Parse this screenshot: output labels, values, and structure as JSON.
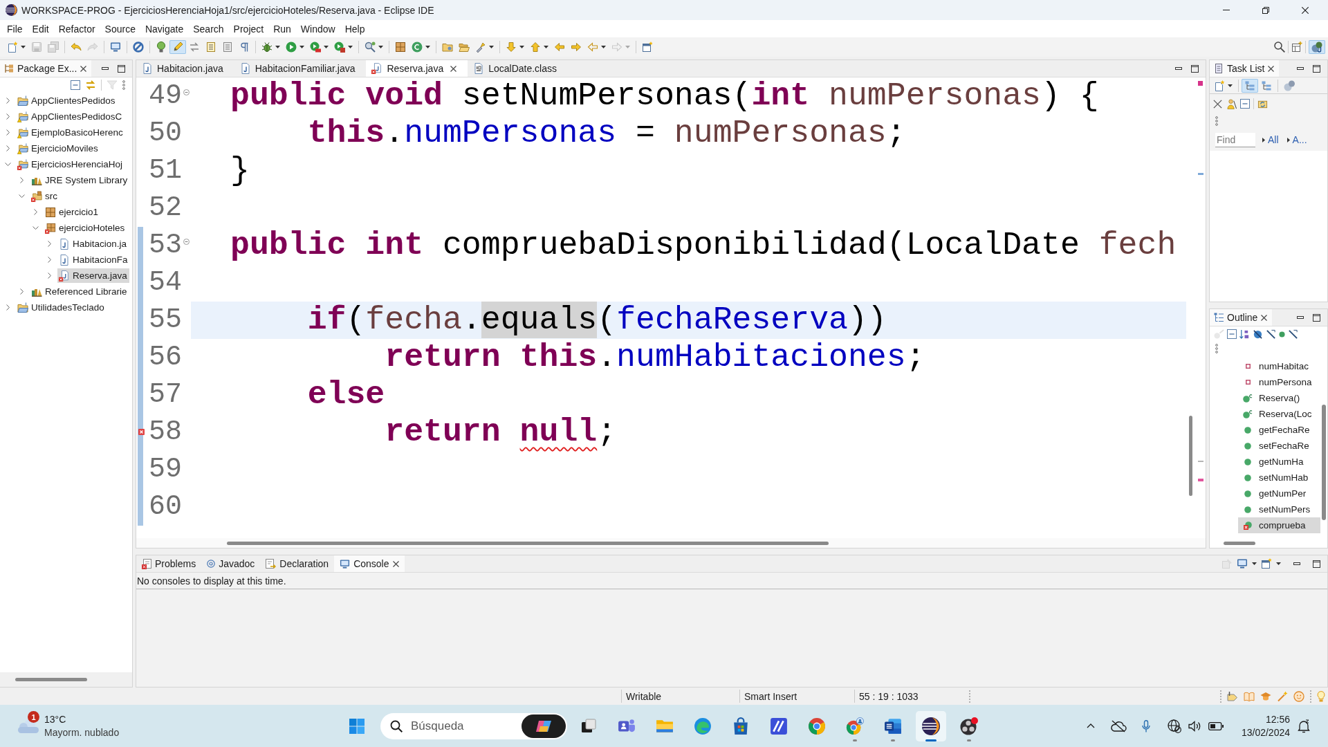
{
  "window": {
    "title": "WORKSPACE-PROG - EjerciciosHerenciaHoja1/src/ejercicioHoteles/Reserva.java - Eclipse IDE"
  },
  "menu": [
    "File",
    "Edit",
    "Refactor",
    "Source",
    "Navigate",
    "Search",
    "Project",
    "Run",
    "Window",
    "Help"
  ],
  "toolbar": [
    [
      {
        "disabled": false,
        "on": false
      },
      {
        "disabled": true,
        "on": false
      },
      {
        "disabled": true,
        "on": false
      }
    ],
    [
      {
        "disabled": false,
        "on": false
      },
      {
        "disabled": true,
        "on": false
      }
    ],
    [
      {
        "disabled": false,
        "on": false
      }
    ],
    [
      {
        "disabled": false,
        "on": false
      }
    ],
    [
      {
        "disabled": false,
        "on": false
      },
      {
        "disabled": false,
        "on": true
      },
      {
        "disabled": false,
        "on": false
      },
      {
        "disabled": false,
        "on": false
      },
      {
        "disabled": false,
        "on": false
      },
      {
        "disabled": false,
        "on": false
      }
    ],
    [
      {
        "disabled": false,
        "on": false
      },
      {
        "disabled": false,
        "on": false
      },
      {
        "disabled": false,
        "on": false
      },
      {
        "disabled": false,
        "on": false
      }
    ],
    [
      {
        "disabled": false,
        "on": false
      }
    ],
    [
      {
        "disabled": false,
        "on": false
      },
      {
        "disabled": false,
        "on": false
      }
    ],
    [
      {
        "disabled": false,
        "on": false
      },
      {
        "disabled": false,
        "on": false
      },
      {
        "disabled": false,
        "on": false
      }
    ],
    [
      {
        "disabled": false,
        "on": false
      },
      {
        "disabled": false,
        "on": false
      },
      {
        "disabled": false,
        "on": false
      },
      {
        "disabled": false,
        "on": false
      },
      {
        "disabled": false,
        "on": false
      },
      {
        "disabled": true,
        "on": false
      }
    ],
    [
      {
        "disabled": false,
        "on": false
      }
    ]
  ],
  "perspectives": [
    {
      "selected": true
    }
  ],
  "package_explorer": {
    "title": "Package Ex...",
    "tree": [
      {
        "label": "AppClientesPedidos",
        "kind": "project",
        "warning": false,
        "error": false,
        "expanded": false,
        "selected": false
      },
      {
        "label": "AppClientesPedidosC",
        "kind": "project",
        "warning": true,
        "error": false,
        "expanded": false,
        "selected": false
      },
      {
        "label": "EjemploBasicoHerenc",
        "kind": "project",
        "warning": true,
        "error": false,
        "expanded": false,
        "selected": false
      },
      {
        "label": "EjercicioMoviles",
        "kind": "project",
        "warning": true,
        "error": false,
        "expanded": false,
        "selected": false
      },
      {
        "label": "EjerciciosHerenciaHoj",
        "kind": "project",
        "warning": false,
        "error": true,
        "expanded": true,
        "selected": false,
        "children": [
          {
            "label": "JRE System Library",
            "kind": "library",
            "warning": false,
            "error": false,
            "expanded": false,
            "selected": false
          },
          {
            "label": "src",
            "kind": "source_folder",
            "warning": false,
            "error": true,
            "expanded": true,
            "selected": false,
            "children": [
              {
                "label": "ejercicio1",
                "kind": "package",
                "warning": false,
                "error": false,
                "expanded": false,
                "selected": false
              },
              {
                "label": "ejercicioHoteles",
                "kind": "package",
                "warning": false,
                "error": true,
                "expanded": true,
                "selected": false,
                "children": [
                  {
                    "label": "Habitacion.ja",
                    "kind": "java",
                    "warning": false,
                    "error": false,
                    "expanded": false,
                    "selected": false
                  },
                  {
                    "label": "HabitacionFa",
                    "kind": "java",
                    "warning": false,
                    "error": false,
                    "expanded": false,
                    "selected": false
                  },
                  {
                    "label": "Reserva.java",
                    "kind": "java",
                    "warning": false,
                    "error": true,
                    "expanded": false,
                    "selected": true
                  }
                ]
              }
            ]
          },
          {
            "label": "Referenced Librarie",
            "kind": "library",
            "warning": false,
            "error": false,
            "expanded": false,
            "selected": false
          }
        ]
      },
      {
        "label": "UtilidadesTeclado",
        "kind": "project",
        "warning": false,
        "error": false,
        "expanded": false,
        "selected": false
      }
    ]
  },
  "editor": {
    "tabs": [
      {
        "label": "Habitacion.java",
        "kind": "java",
        "error": false,
        "selected": false
      },
      {
        "label": "HabitacionFamiliar.java",
        "kind": "java",
        "error": false,
        "selected": false
      },
      {
        "label": "Reserva.java",
        "kind": "java",
        "error": true,
        "selected": true
      },
      {
        "label": "LocalDate.class",
        "kind": "class",
        "error": false,
        "selected": false
      }
    ],
    "lines": [
      {
        "number": "49",
        "fold": true,
        "error": false,
        "in_range": false,
        "current": false,
        "tokens": [
          {
            "kind": "keyword",
            "text": "public void"
          },
          {
            "kind": "plain",
            "text": " setNumPersonas("
          },
          {
            "kind": "keyword",
            "text": "int"
          },
          {
            "kind": "parameter",
            "text": " numPersonas"
          },
          {
            "kind": "plain",
            "text": ") {"
          }
        ]
      },
      {
        "number": "50",
        "fold": false,
        "error": false,
        "in_range": false,
        "current": false,
        "tokens": [
          {
            "kind": "keyword",
            "text": "    this"
          },
          {
            "kind": "plain",
            "text": "."
          },
          {
            "kind": "field",
            "text": "numPersonas"
          },
          {
            "kind": "plain",
            "text": " = "
          },
          {
            "kind": "parameter",
            "text": "numPersonas"
          },
          {
            "kind": "plain",
            "text": ";"
          }
        ]
      },
      {
        "number": "51",
        "fold": false,
        "error": false,
        "in_range": false,
        "current": false,
        "tokens": [
          {
            "kind": "plain",
            "text": "}"
          }
        ]
      },
      {
        "number": "52",
        "fold": false,
        "error": false,
        "in_range": false,
        "current": false
      },
      {
        "number": "53",
        "fold": true,
        "error": false,
        "in_range": true,
        "current": false,
        "tokens": [
          {
            "kind": "keyword",
            "text": "public int"
          },
          {
            "kind": "plain",
            "text": " compruebaDisponibilidad(LocalDate "
          },
          {
            "kind": "parameter",
            "text": "fech"
          }
        ]
      },
      {
        "number": "54",
        "fold": false,
        "error": false,
        "in_range": true,
        "current": false
      },
      {
        "number": "55",
        "fold": false,
        "error": false,
        "in_range": true,
        "current": true,
        "tokens": [
          {
            "kind": "keyword",
            "text": "    if"
          },
          {
            "kind": "plain",
            "text": "("
          },
          {
            "kind": "parameter",
            "text": "fecha"
          },
          {
            "kind": "plain",
            "text": "."
          },
          {
            "kind": "occurrence",
            "text": "equals"
          },
          {
            "kind": "plain",
            "text": "("
          },
          {
            "kind": "field",
            "text": "fechaReserva"
          },
          {
            "kind": "plain",
            "text": "))"
          }
        ]
      },
      {
        "number": "56",
        "fold": false,
        "error": false,
        "in_range": true,
        "current": false,
        "tokens": [
          {
            "kind": "keyword",
            "text": "        return this"
          },
          {
            "kind": "plain",
            "text": "."
          },
          {
            "kind": "field",
            "text": "numHabitaciones"
          },
          {
            "kind": "plain",
            "text": ";"
          }
        ]
      },
      {
        "number": "57",
        "fold": false,
        "error": false,
        "in_range": true,
        "current": false,
        "tokens": [
          {
            "kind": "keyword",
            "text": "    else"
          }
        ]
      },
      {
        "number": "58",
        "fold": false,
        "error": true,
        "in_range": true,
        "current": false,
        "tokens": [
          {
            "kind": "keyword",
            "text": "        return "
          },
          {
            "kind": "error",
            "text": "null"
          },
          {
            "kind": "plain",
            "text": ";"
          }
        ]
      },
      {
        "number": "59",
        "fold": false,
        "error": false,
        "in_range": true,
        "current": false
      },
      {
        "number": "60",
        "fold": false,
        "error": false,
        "in_range": true,
        "current": false
      }
    ]
  },
  "task_list": {
    "title": "Task List",
    "toolbar": [
      {
        "on": false
      },
      {
        "on": true
      },
      {
        "on": false
      },
      {
        "on": false
      }
    ],
    "find": {
      "placeholder": "Find"
    },
    "filters": [
      {
        "label": "All"
      },
      {
        "label": "A..."
      }
    ]
  },
  "outline": {
    "title": "Outline",
    "items": [
      {
        "label": "numHabitac",
        "kind": "field",
        "error": false,
        "selected": false
      },
      {
        "label": "numPersona",
        "kind": "field",
        "error": false,
        "selected": false
      },
      {
        "label": "Reserva()",
        "kind": "constructor",
        "error": false,
        "selected": false
      },
      {
        "label": "Reserva(Loc",
        "kind": "constructor",
        "error": false,
        "selected": false
      },
      {
        "label": "getFechaRe",
        "kind": "method",
        "error": false,
        "selected": false
      },
      {
        "label": "setFechaRe",
        "kind": "method",
        "error": false,
        "selected": false
      },
      {
        "label": "getNumHa",
        "kind": "method",
        "error": false,
        "selected": false
      },
      {
        "label": "setNumHab",
        "kind": "method",
        "error": false,
        "selected": false
      },
      {
        "label": "getNumPer",
        "kind": "method",
        "error": false,
        "selected": false
      },
      {
        "label": "setNumPers",
        "kind": "method",
        "error": false,
        "selected": false
      },
      {
        "label": "comprueba",
        "kind": "method",
        "error": true,
        "selected": true
      }
    ]
  },
  "bottom_panel": {
    "tabs": [
      {
        "label": "Problems",
        "selected": false
      },
      {
        "label": "Javadoc",
        "selected": false
      },
      {
        "label": "Declaration",
        "selected": false
      },
      {
        "label": "Console",
        "selected": true
      }
    ],
    "message": "No consoles to display at this time."
  },
  "status_bar": [
    "Writable",
    "Smart Insert",
    "55 : 19 : 1033"
  ],
  "taskbar": {
    "weather": {
      "badge": "1",
      "temperature": "13°C",
      "condition": "Mayorm. nublado"
    },
    "search": {
      "placeholder": "Búsqueda"
    },
    "apps": [
      {
        "running": false,
        "selected": false
      },
      {
        "running": false,
        "selected": false
      },
      {
        "running": false,
        "selected": false
      },
      {
        "running": false,
        "selected": false
      },
      {
        "running": false,
        "selected": false
      },
      {
        "running": false,
        "selected": false
      },
      {
        "running": false,
        "selected": false
      },
      {
        "running": true,
        "selected": false
      },
      {
        "running": true,
        "selected": false
      },
      {
        "running": true,
        "selected": true
      },
      {
        "running": true,
        "selected": false
      }
    ],
    "clock": {
      "time": "12:56",
      "date": "13/02/2024"
    }
  }
}
